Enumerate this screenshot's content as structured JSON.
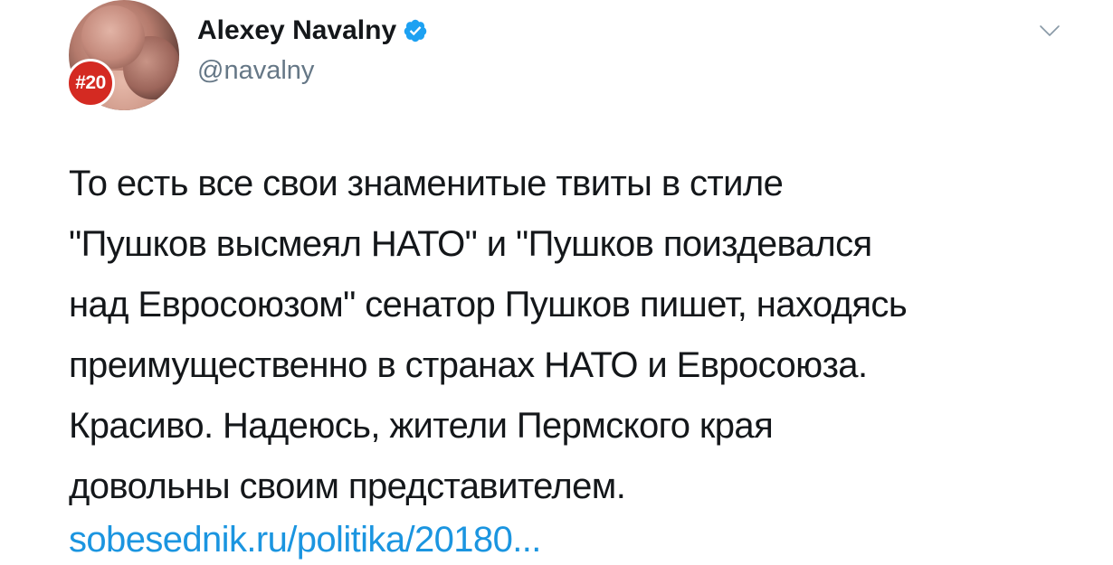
{
  "author": {
    "display_name": "Alexey Navalny",
    "handle": "@navalny",
    "avatar_badge": "#20",
    "verified": true
  },
  "tweet": {
    "lines": [
      "То есть все свои знаменитые твиты в стиле",
      "\"Пушков высмеял НАТО\" и \"Пушков поиздевался",
      "над Евросоюзом\" сенатор Пушков пишет, находясь",
      "преимущественно в странах НАТО и Евросоюза.",
      "Красиво. Надеюсь, жители Пермского края",
      "довольны своим представителем."
    ],
    "link_text": "sobesednik.ru/politika/20180..."
  },
  "icons": {
    "verified": "verified-badge-icon",
    "menu": "chevron-down-icon"
  },
  "colors": {
    "text": "#14171a",
    "secondary": "#657786",
    "link": "#1b95e0",
    "verified": "#1da1f2",
    "badge": "#d42a22"
  }
}
